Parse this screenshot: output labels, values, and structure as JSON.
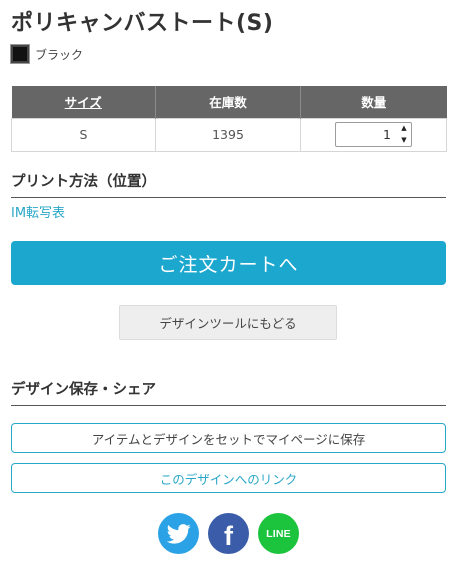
{
  "product": {
    "title": "ポリキャンバストート(S)",
    "color_name": "ブラック",
    "color_hex": "#111111"
  },
  "stock_table": {
    "headers": [
      "サイズ",
      "在庫数",
      "数量"
    ],
    "rows": [
      {
        "size": "S",
        "stock": "1395",
        "quantity": "1"
      }
    ]
  },
  "print_section": {
    "heading": "プリント方法（位置）",
    "method": "IM転写表"
  },
  "actions": {
    "order_label": "ご注文カートへ",
    "back_to_tool_label": "デザインツールにもどる"
  },
  "save_section": {
    "heading": "デザイン保存・シェア",
    "save_label": "アイテムとデザインをセットでマイページに保存",
    "link_label": "このデザインへのリンク"
  },
  "social": {
    "icons": [
      "twitter-icon",
      "facebook-icon",
      "line-icon"
    ],
    "line_text": "LINE",
    "facebook_letter": "f"
  },
  "colors": {
    "accent": "#1ca7cf",
    "link": "#29a7c8",
    "table_header": "#666666",
    "twitter": "#2aa2e5",
    "facebook": "#3b5ca8",
    "line": "#1cc33d"
  }
}
